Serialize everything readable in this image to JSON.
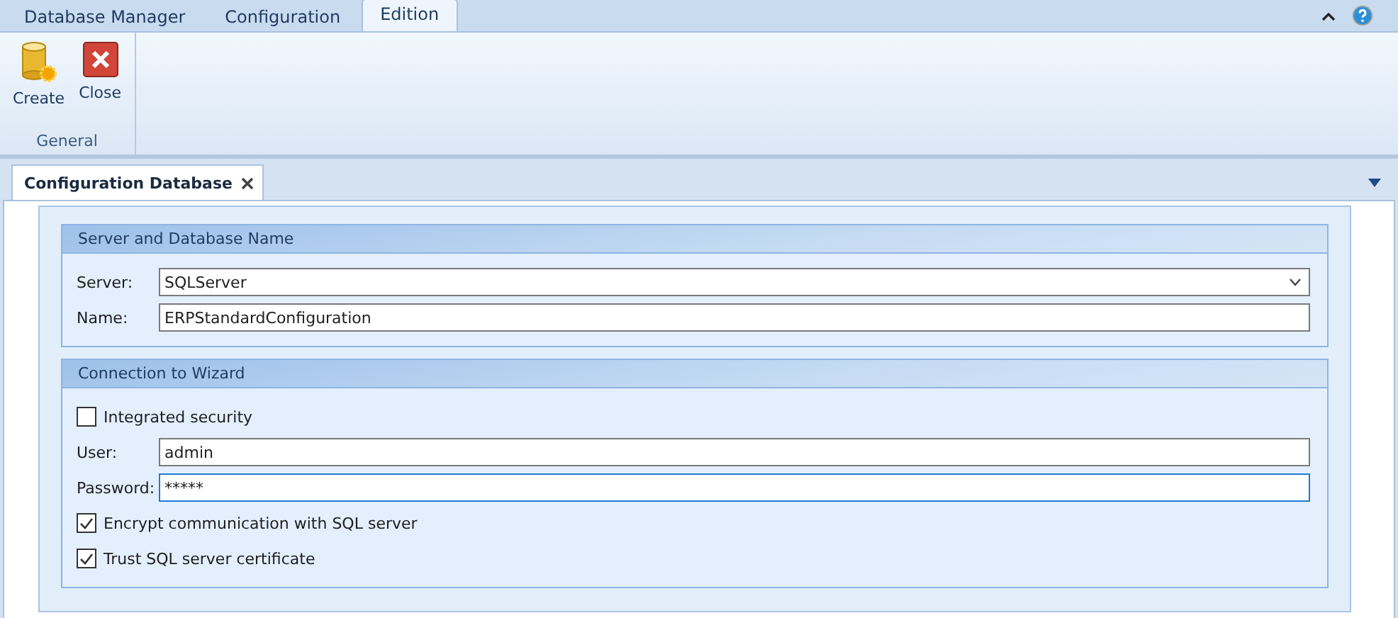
{
  "ribbon_tabs": [
    {
      "label": "Database Manager",
      "selected": false
    },
    {
      "label": "Configuration",
      "selected": false
    },
    {
      "label": "Edition",
      "selected": true
    }
  ],
  "ribbon_groups": [
    {
      "label": "General",
      "buttons": [
        {
          "label": "Create",
          "kind": "create"
        },
        {
          "label": "Close",
          "kind": "close"
        }
      ]
    }
  ],
  "document_tabs": [
    {
      "label": "Configuration Database",
      "selected": true
    }
  ],
  "sections": [
    {
      "title": "Server and Database Name",
      "items": [
        {
          "kind": "combo",
          "label": "Server:",
          "value": "SQLServer",
          "focused": false
        },
        {
          "kind": "field",
          "label": "Name:",
          "value": "ERPStandardConfiguration",
          "focused": false
        }
      ]
    },
    {
      "title": "Connection to Wizard",
      "items": [
        {
          "kind": "checkbox",
          "label": "Integrated security",
          "checked": false
        },
        {
          "kind": "field",
          "label": "User:",
          "value": "admin",
          "focused": false
        },
        {
          "kind": "field",
          "label": "Password:",
          "value": "*****",
          "focused": true
        },
        {
          "kind": "checkbox",
          "label": "Encrypt communication with SQL server",
          "checked": true
        },
        {
          "kind": "checkbox",
          "label": "Trust SQL server certificate",
          "checked": true
        }
      ]
    }
  ]
}
